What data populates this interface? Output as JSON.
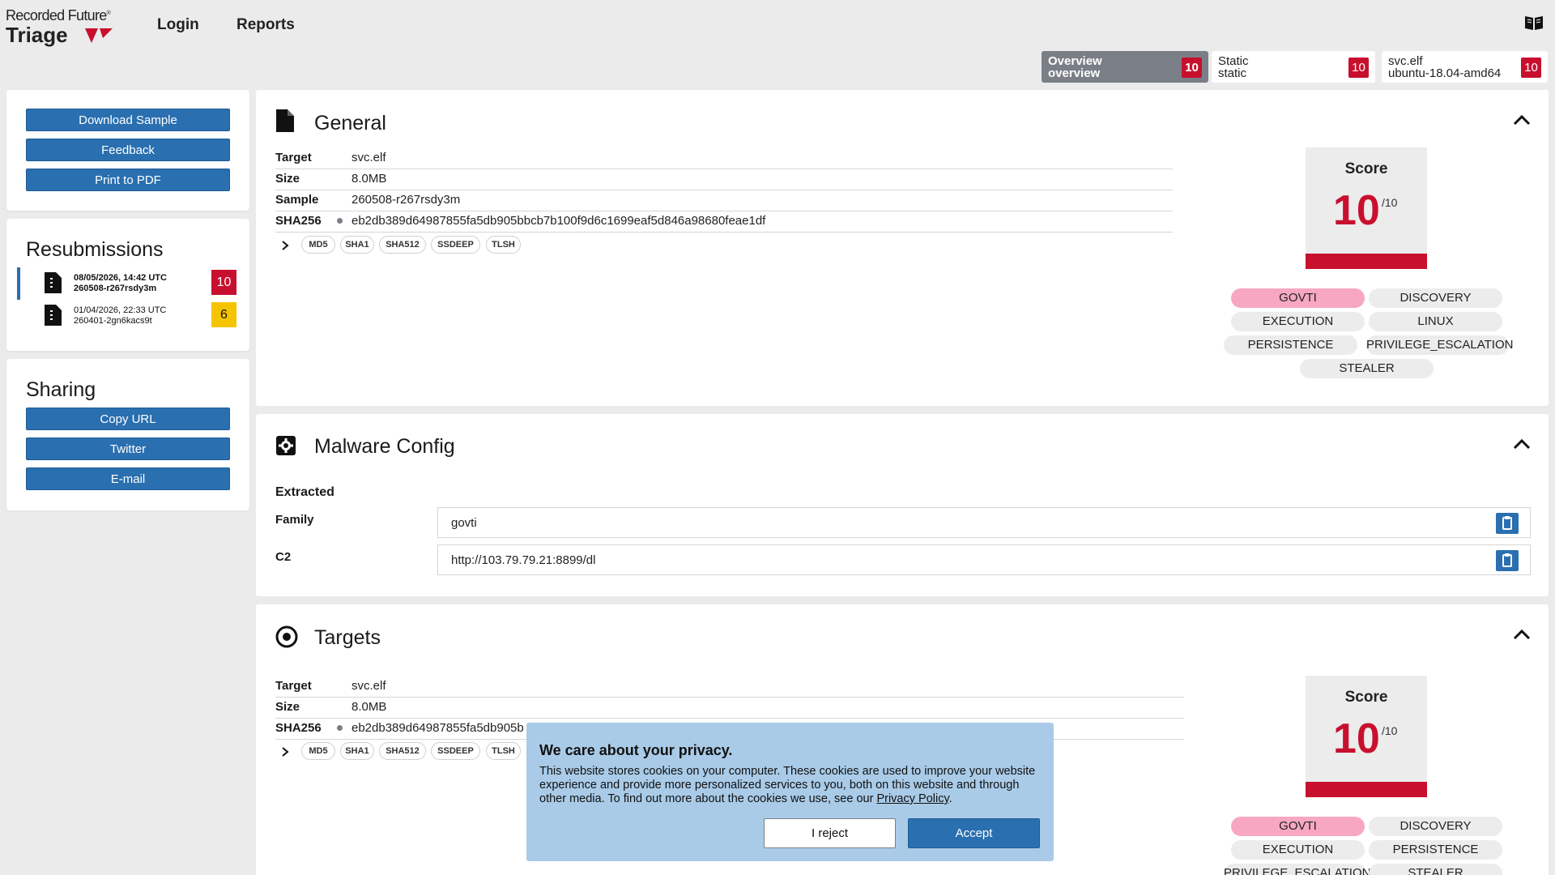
{
  "brand": {
    "line1": "Recorded Future",
    "trademark": "®",
    "line2": "Triage",
    "accent_color": "#c8102e"
  },
  "nav": {
    "login": "Login",
    "reports": "Reports"
  },
  "report_tabs": [
    {
      "title": "Overview",
      "sub": "overview",
      "score": "10"
    },
    {
      "title": "Static",
      "sub": "static",
      "score": "10"
    },
    {
      "title": "svc.elf",
      "sub": "ubuntu-18.04-amd64",
      "score": "10"
    }
  ],
  "actions": {
    "download": "Download Sample",
    "feedback": "Feedback",
    "pdf": "Print to PDF"
  },
  "resubmissions": {
    "title": "Resubmissions",
    "items": [
      {
        "date": "08/05/2026, 14:42 UTC",
        "id": "260508-r267rsdy3m",
        "score": "10",
        "score_color": "#c8102e"
      },
      {
        "date": "01/04/2026, 22:33 UTC",
        "id": "260401-2gn6kacs9t",
        "score": "6",
        "score_color": "#f5c400"
      }
    ]
  },
  "sharing": {
    "title": "Sharing",
    "copy": "Copy URL",
    "twitter": "Twitter",
    "email": "E-mail"
  },
  "general": {
    "title": "General",
    "rows": [
      {
        "key": "Target",
        "value": "svc.elf"
      },
      {
        "key": "Size",
        "value": "8.0MB"
      },
      {
        "key": "Sample",
        "value": "260508-r267rsdy3m"
      },
      {
        "key": "SHA256",
        "value": "eb2db389d64987855fa5db905bbcb7b100f9d6c1699eaf5d846a98680feae1df"
      }
    ],
    "hashes": [
      "MD5",
      "SHA1",
      "SHA512",
      "SSDEEP",
      "TLSH"
    ],
    "score_label": "Score",
    "score": "10",
    "score_max": "/10",
    "tags": [
      "GOVTI",
      "DISCOVERY",
      "EXECUTION",
      "LINUX",
      "PERSISTENCE",
      "PRIVILEGE_ESCALATION",
      "STEALER"
    ]
  },
  "malware_config": {
    "title": "Malware Config",
    "extracted": "Extracted",
    "family_label": "Family",
    "family": "govti",
    "c2_label": "C2",
    "c2": "http://103.79.79.21:8899/dl"
  },
  "targets": {
    "title": "Targets",
    "rows": [
      {
        "key": "Target",
        "value": "svc.elf"
      },
      {
        "key": "Size",
        "value": "8.0MB"
      },
      {
        "key": "SHA256",
        "value": "eb2db389d64987855fa5db905b"
      }
    ],
    "hashes": [
      "MD5",
      "SHA1",
      "SHA512",
      "SSDEEP",
      "TLSH"
    ],
    "score_label": "Score",
    "score": "10",
    "score_max": "/10",
    "tags": [
      "GOVTI",
      "DISCOVERY",
      "EXECUTION",
      "PERSISTENCE",
      "PRIVILEGE_ESCALATION",
      "STEALER"
    ]
  },
  "privacy": {
    "title": "We care about your privacy.",
    "body": "This website stores cookies on your computer. These cookies are used to improve your website experience and provide more personalized services to you, both on this website and through other media. To find out more about the cookies we use, see our ",
    "policy_link": "Privacy Policy",
    "period": ".",
    "reject": "I reject",
    "accept": "Accept"
  }
}
